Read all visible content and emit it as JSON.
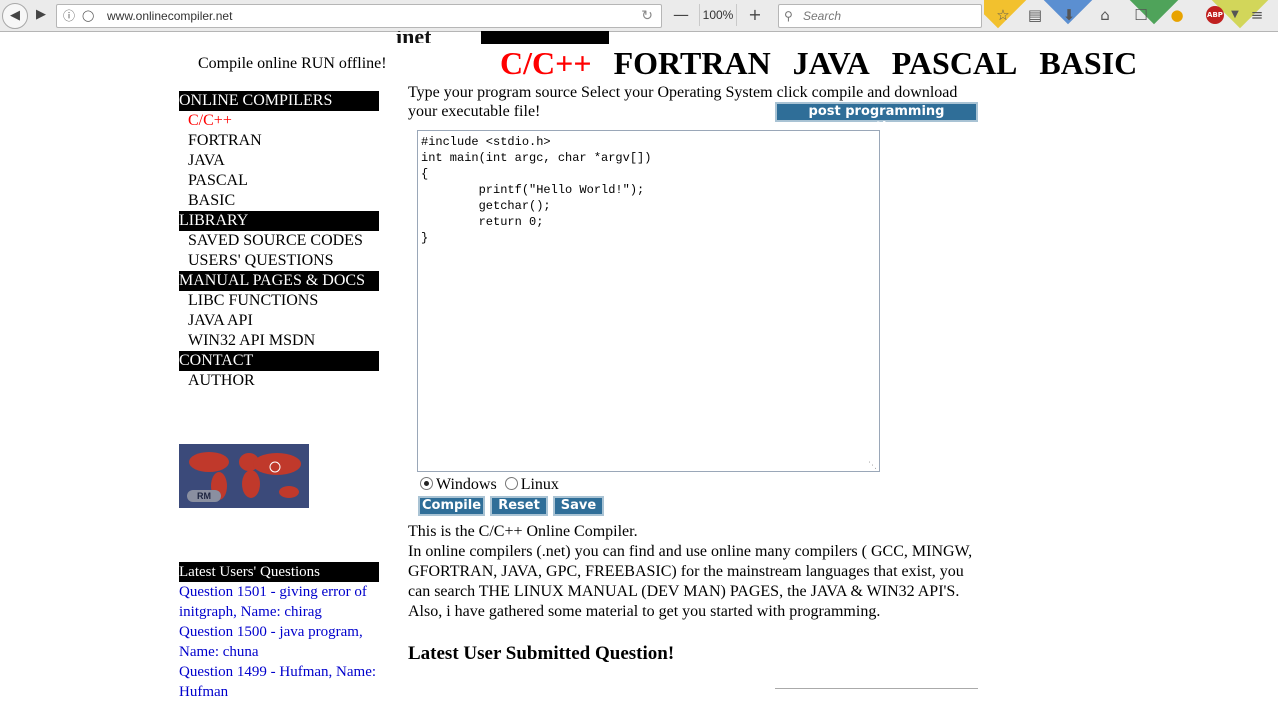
{
  "browser": {
    "url": "www.onlinecompiler.net",
    "zoom": "100%",
    "search_placeholder": "Search",
    "abp_label": "ABP"
  },
  "header": {
    "tagline": "Compile online RUN offline!",
    "languages": [
      "C/C++",
      "FORTRAN",
      "JAVA",
      "PASCAL",
      "BASIC"
    ],
    "active_language": "C/C++"
  },
  "sidebar": {
    "sections": [
      {
        "title": "ONLINE COMPILERS",
        "items": [
          "C/C++",
          "FORTRAN",
          "JAVA",
          "PASCAL",
          "BASIC"
        ]
      },
      {
        "title": "LIBRARY",
        "items": [
          "SAVED SOURCE CODES",
          "USERS' QUESTIONS"
        ]
      },
      {
        "title": "MANUAL PAGES & DOCS",
        "items": [
          "LIBC FUNCTIONS",
          "JAVA API",
          "WIN32 API MSDN"
        ]
      },
      {
        "title": "CONTACT",
        "items": [
          "AUTHOR"
        ]
      }
    ],
    "map_badge": "RM"
  },
  "latest_questions": {
    "title": "Latest Users' Questions",
    "items": [
      "Question 1501 - giving error of initgraph, Name: chirag",
      "Question 1500 - java program, Name: chuna",
      "Question 1499 - Hufman, Name: Hufman"
    ]
  },
  "main": {
    "intro": "Type your program source Select your Operating System click compile and download your executable file!",
    "post_button": "post programming questions",
    "source_code": "#include <stdio.h>\nint main(int argc, char *argv[])\n{\n        printf(\"Hello World!\");\n        getchar();\n        return 0;\n}",
    "os_options": [
      "Windows",
      "Linux"
    ],
    "selected_os": "Windows",
    "buttons": {
      "compile": "Compile",
      "reset": "Reset",
      "save": "Save"
    },
    "description_title": "This is the C/C++ Online Compiler.",
    "description_body": "In online compilers (.net) you can find and use online many compilers ( GCC, MINGW, GFORTRAN, JAVA, GPC, FREEBASIC) for the mainstream languages that exist, you can search THE LINUX MANUAL (DEV MAN) PAGES, the JAVA & WIN32 API'S. Also, i have gathered some material to get you started with programming.",
    "latest_title": "Latest User Submitted Question!"
  }
}
